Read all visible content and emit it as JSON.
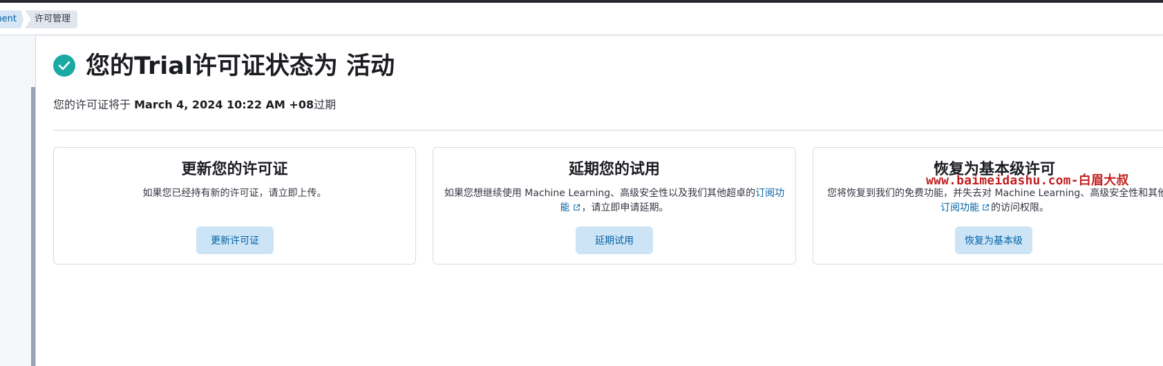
{
  "breadcrumb": {
    "parent": "ment",
    "current": "许可管理"
  },
  "status": {
    "title": "您的Trial许可证状态为 活动",
    "icon": "check-circle-icon",
    "color": "#1ba9a3"
  },
  "expiry": {
    "prefix": "您的许可证将于 ",
    "date": "March 4, 2024 10:22 AM +08",
    "suffix": "过期"
  },
  "cards": {
    "update": {
      "title": "更新您的许可证",
      "description": "如果您已经持有新的许可证，请立即上传。",
      "button": "更新许可证"
    },
    "extend": {
      "title": "延期您的试用",
      "description_before": "如果您想继续使用 Machine Learning、高级安全性以及我们其他超卓的",
      "link": "订阅功能",
      "description_after": "，请立即申请延期。",
      "button": "延期试用"
    },
    "revert": {
      "title": "恢复为基本级许可",
      "description_before": "您将恢复到我们的免费功能，并失去对 Machine Learning、高级安全性和其他",
      "link": "订阅功能",
      "description_after": "的访问权限。",
      "button": "恢复为基本级"
    }
  },
  "watermark": "www.baimeidashu.com-白眉大叔",
  "colors": {
    "accent": "#0061a6",
    "button_bg": "#cce4f5",
    "success": "#1ba9a3"
  }
}
